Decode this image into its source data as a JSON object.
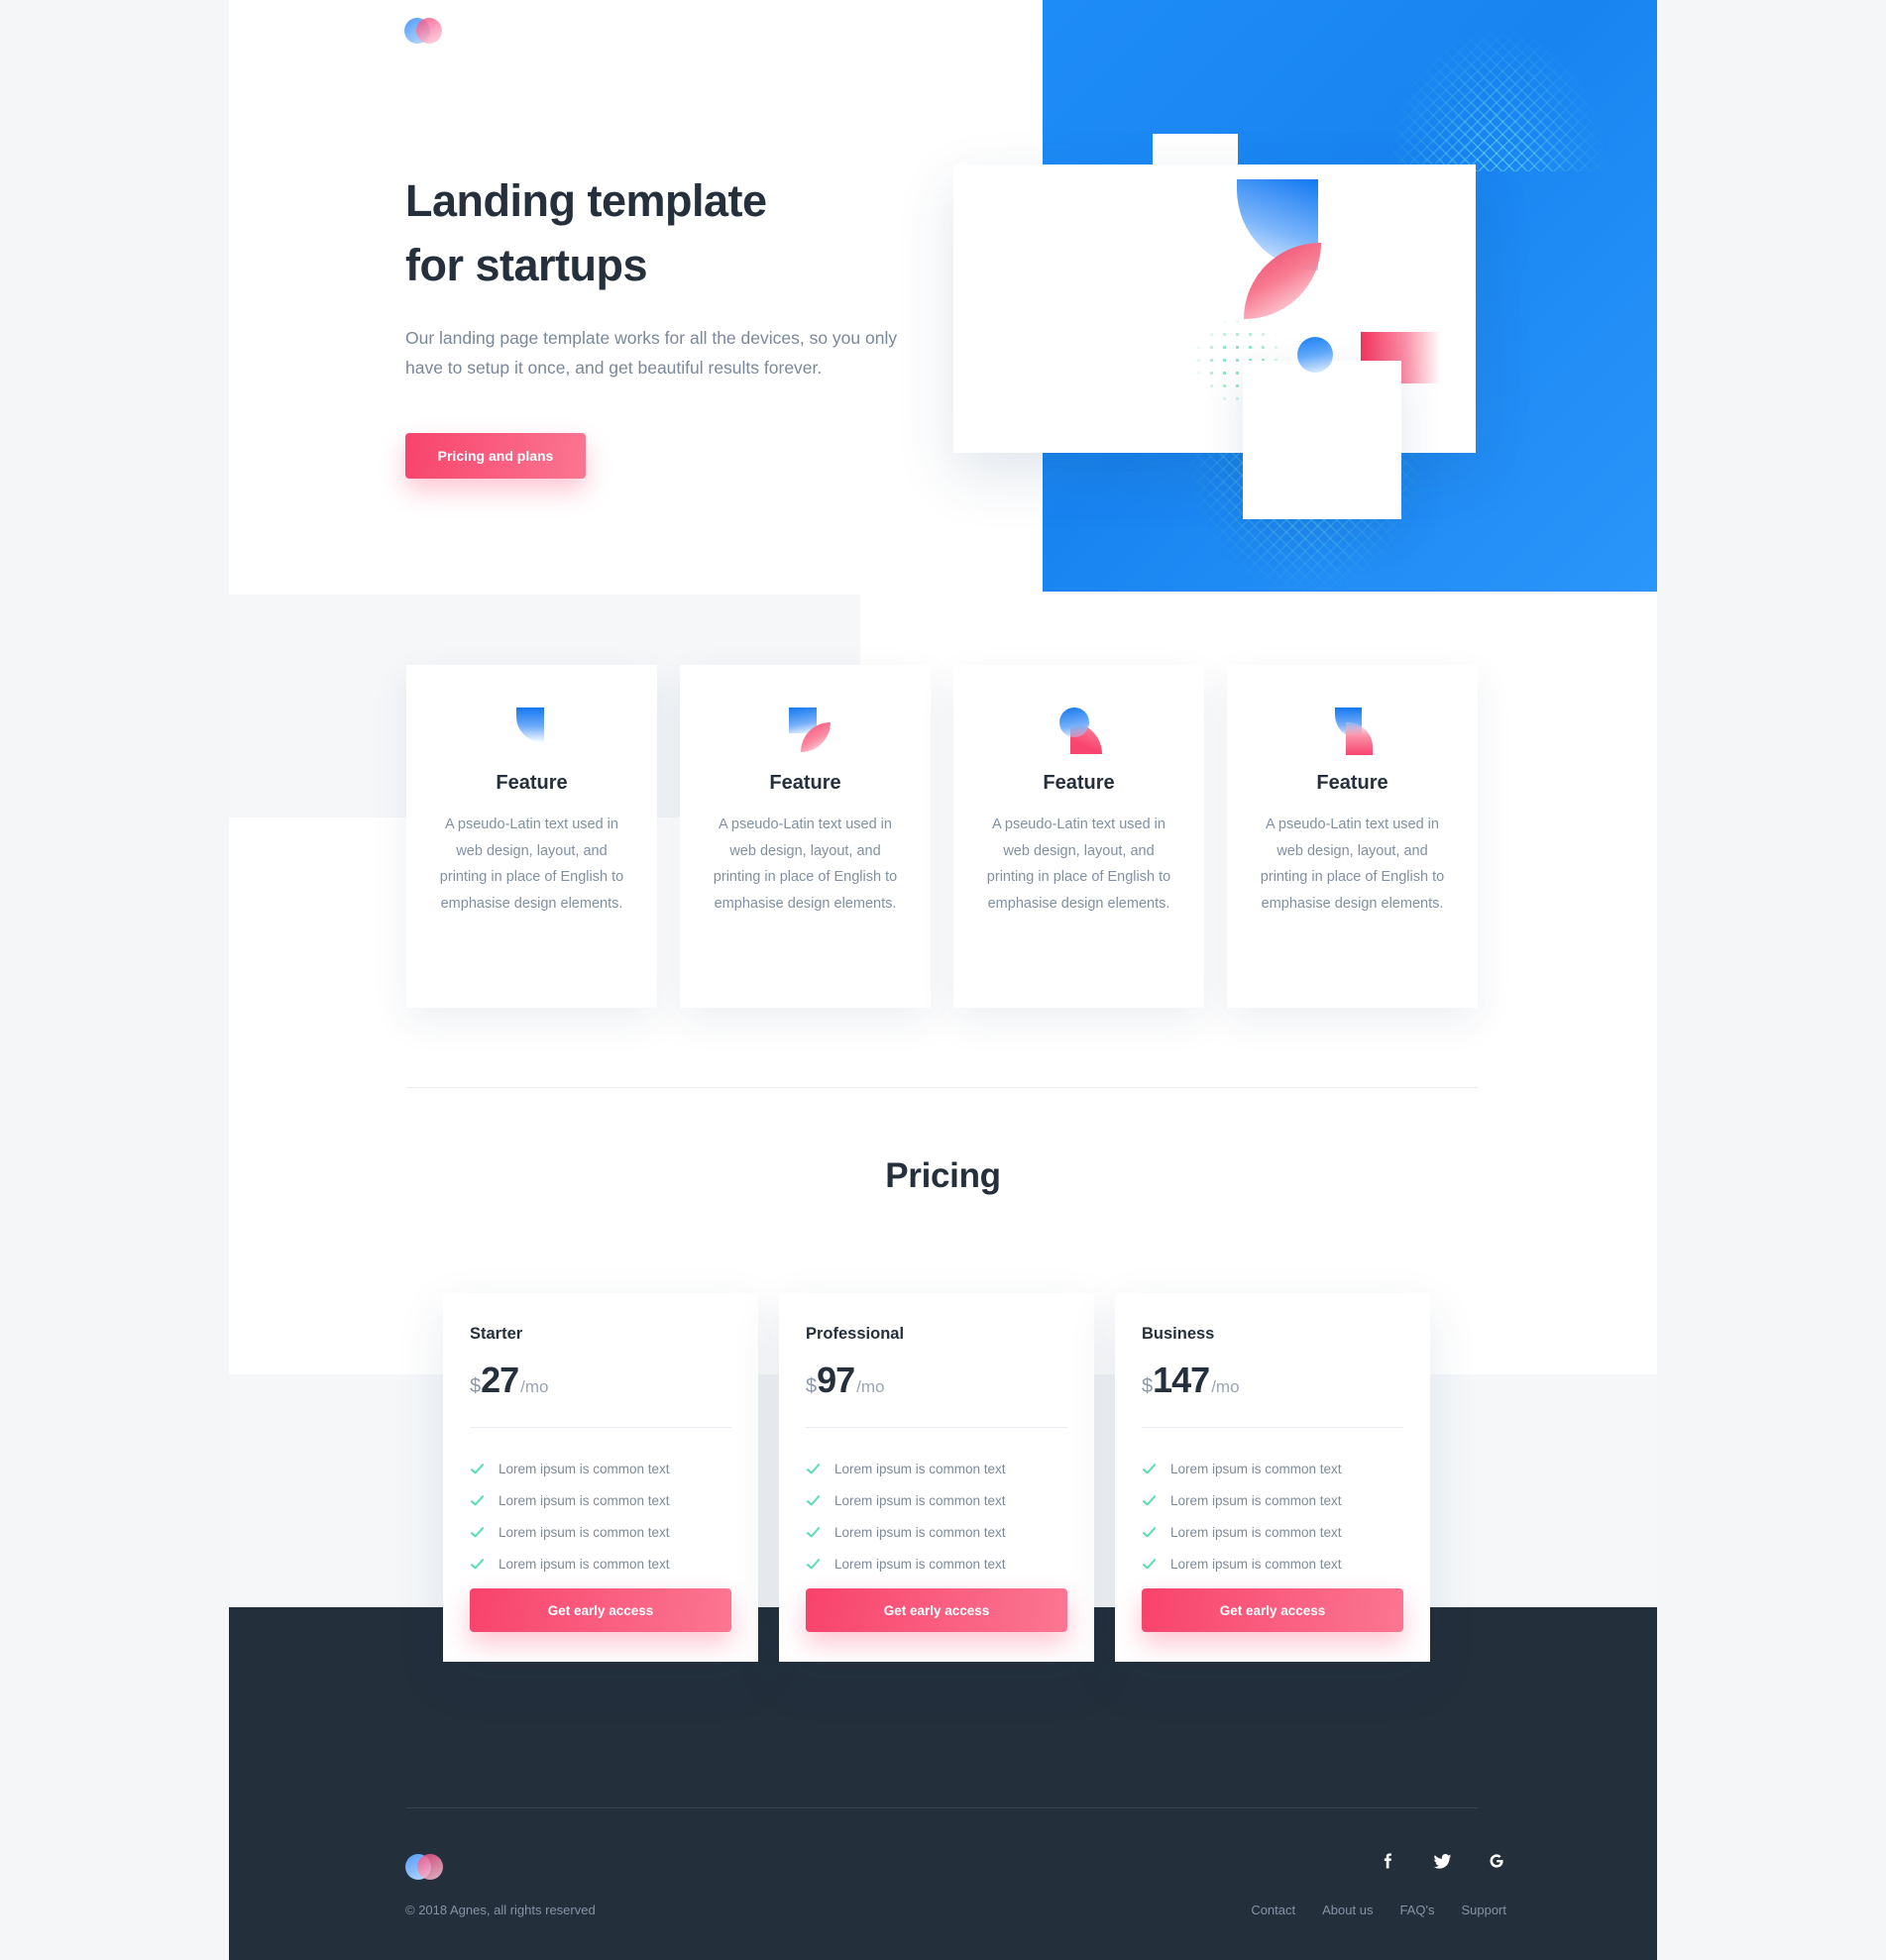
{
  "brand": {
    "logo_icon": "two-overlapping-circles-logo"
  },
  "hero": {
    "title_line1": "Landing template",
    "title_line2": "for startups",
    "subtitle": "Our landing page template works for all the devices, so you only have to setup it once, and get beautiful results forever.",
    "cta_label": "Pricing and plans",
    "accent_blue": "#1e8cf6",
    "accent_pink": "#f8436c"
  },
  "features": [
    {
      "icon": "block-leaf-icon",
      "title": "Feature",
      "desc": "A pseudo-Latin text used in web design, layout, and printing in place of English to emphasise design elements."
    },
    {
      "icon": "square-leaf-icon",
      "title": "Feature",
      "desc": "A pseudo-Latin text used in web design, layout, and printing in place of English to emphasise design elements."
    },
    {
      "icon": "circle-quarter-icon",
      "title": "Feature",
      "desc": "A pseudo-Latin text used in web design, layout, and printing in place of English to emphasise design elements."
    },
    {
      "icon": "s-shape-icon",
      "title": "Feature",
      "desc": "A pseudo-Latin text used in web design, layout, and printing in place of English to emphasise design elements."
    }
  ],
  "pricing": {
    "heading": "Pricing",
    "plans": [
      {
        "name": "Starter",
        "currency": "$",
        "amount": "27",
        "period": "/mo",
        "features": [
          "Lorem ipsum is common text",
          "Lorem ipsum is common text",
          "Lorem ipsum is common text",
          "Lorem ipsum is common text"
        ],
        "cta": "Get early access"
      },
      {
        "name": "Professional",
        "currency": "$",
        "amount": "97",
        "period": "/mo",
        "features": [
          "Lorem ipsum is common text",
          "Lorem ipsum is common text",
          "Lorem ipsum is common text",
          "Lorem ipsum is common text"
        ],
        "cta": "Get early access"
      },
      {
        "name": "Business",
        "currency": "$",
        "amount": "147",
        "period": "/mo",
        "features": [
          "Lorem ipsum is common text",
          "Lorem ipsum is common text",
          "Lorem ipsum is common text",
          "Lorem ipsum is common text"
        ],
        "cta": "Get early access"
      }
    ],
    "check_color": "#5fdfb0"
  },
  "footer": {
    "copyright": "© 2018 Agnes, all rights reserved",
    "socials": [
      "facebook-icon",
      "twitter-icon",
      "google-icon"
    ],
    "links": [
      "Contact",
      "About us",
      "FAQ's",
      "Support"
    ],
    "background": "#232f3b"
  }
}
